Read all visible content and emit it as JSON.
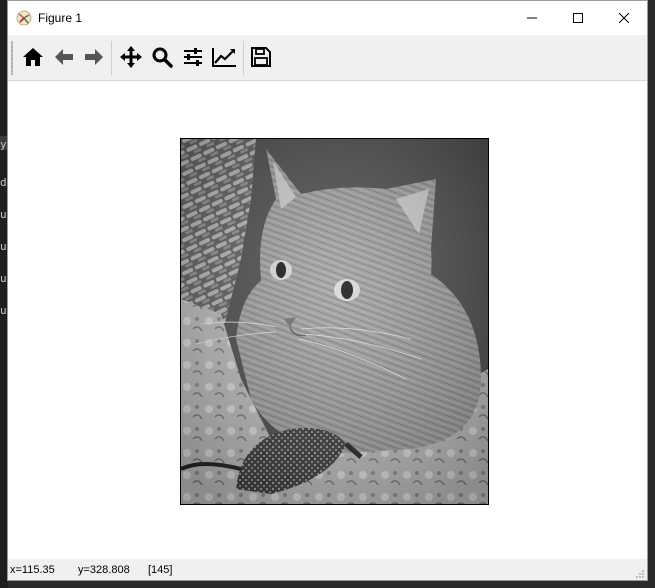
{
  "window": {
    "title": "Figure 1"
  },
  "toolbar": {
    "buttons": [
      {
        "name": "home",
        "icon": "home-icon"
      },
      {
        "name": "back",
        "icon": "arrow-left-icon"
      },
      {
        "name": "forward",
        "icon": "arrow-right-icon"
      },
      {
        "name": "pan",
        "icon": "move-icon"
      },
      {
        "name": "zoom",
        "icon": "magnifier-icon"
      },
      {
        "name": "subplots",
        "icon": "sliders-icon"
      },
      {
        "name": "edit-axes",
        "icon": "line-chart-icon"
      },
      {
        "name": "save",
        "icon": "floppy-disk-icon"
      }
    ]
  },
  "figure": {
    "image_description_icon": "grayscale-cat-image"
  },
  "status": {
    "x": "x=115.35",
    "y": "y=328.808",
    "value": "[145]"
  },
  "background_editor": {
    "lines": [
      "y",
      "d",
      "u",
      "u",
      "u",
      "u"
    ]
  },
  "colors": {
    "window_bg": "#ffffff",
    "toolbar_bg": "#f0f0f0",
    "border": "#9a9a9a"
  }
}
